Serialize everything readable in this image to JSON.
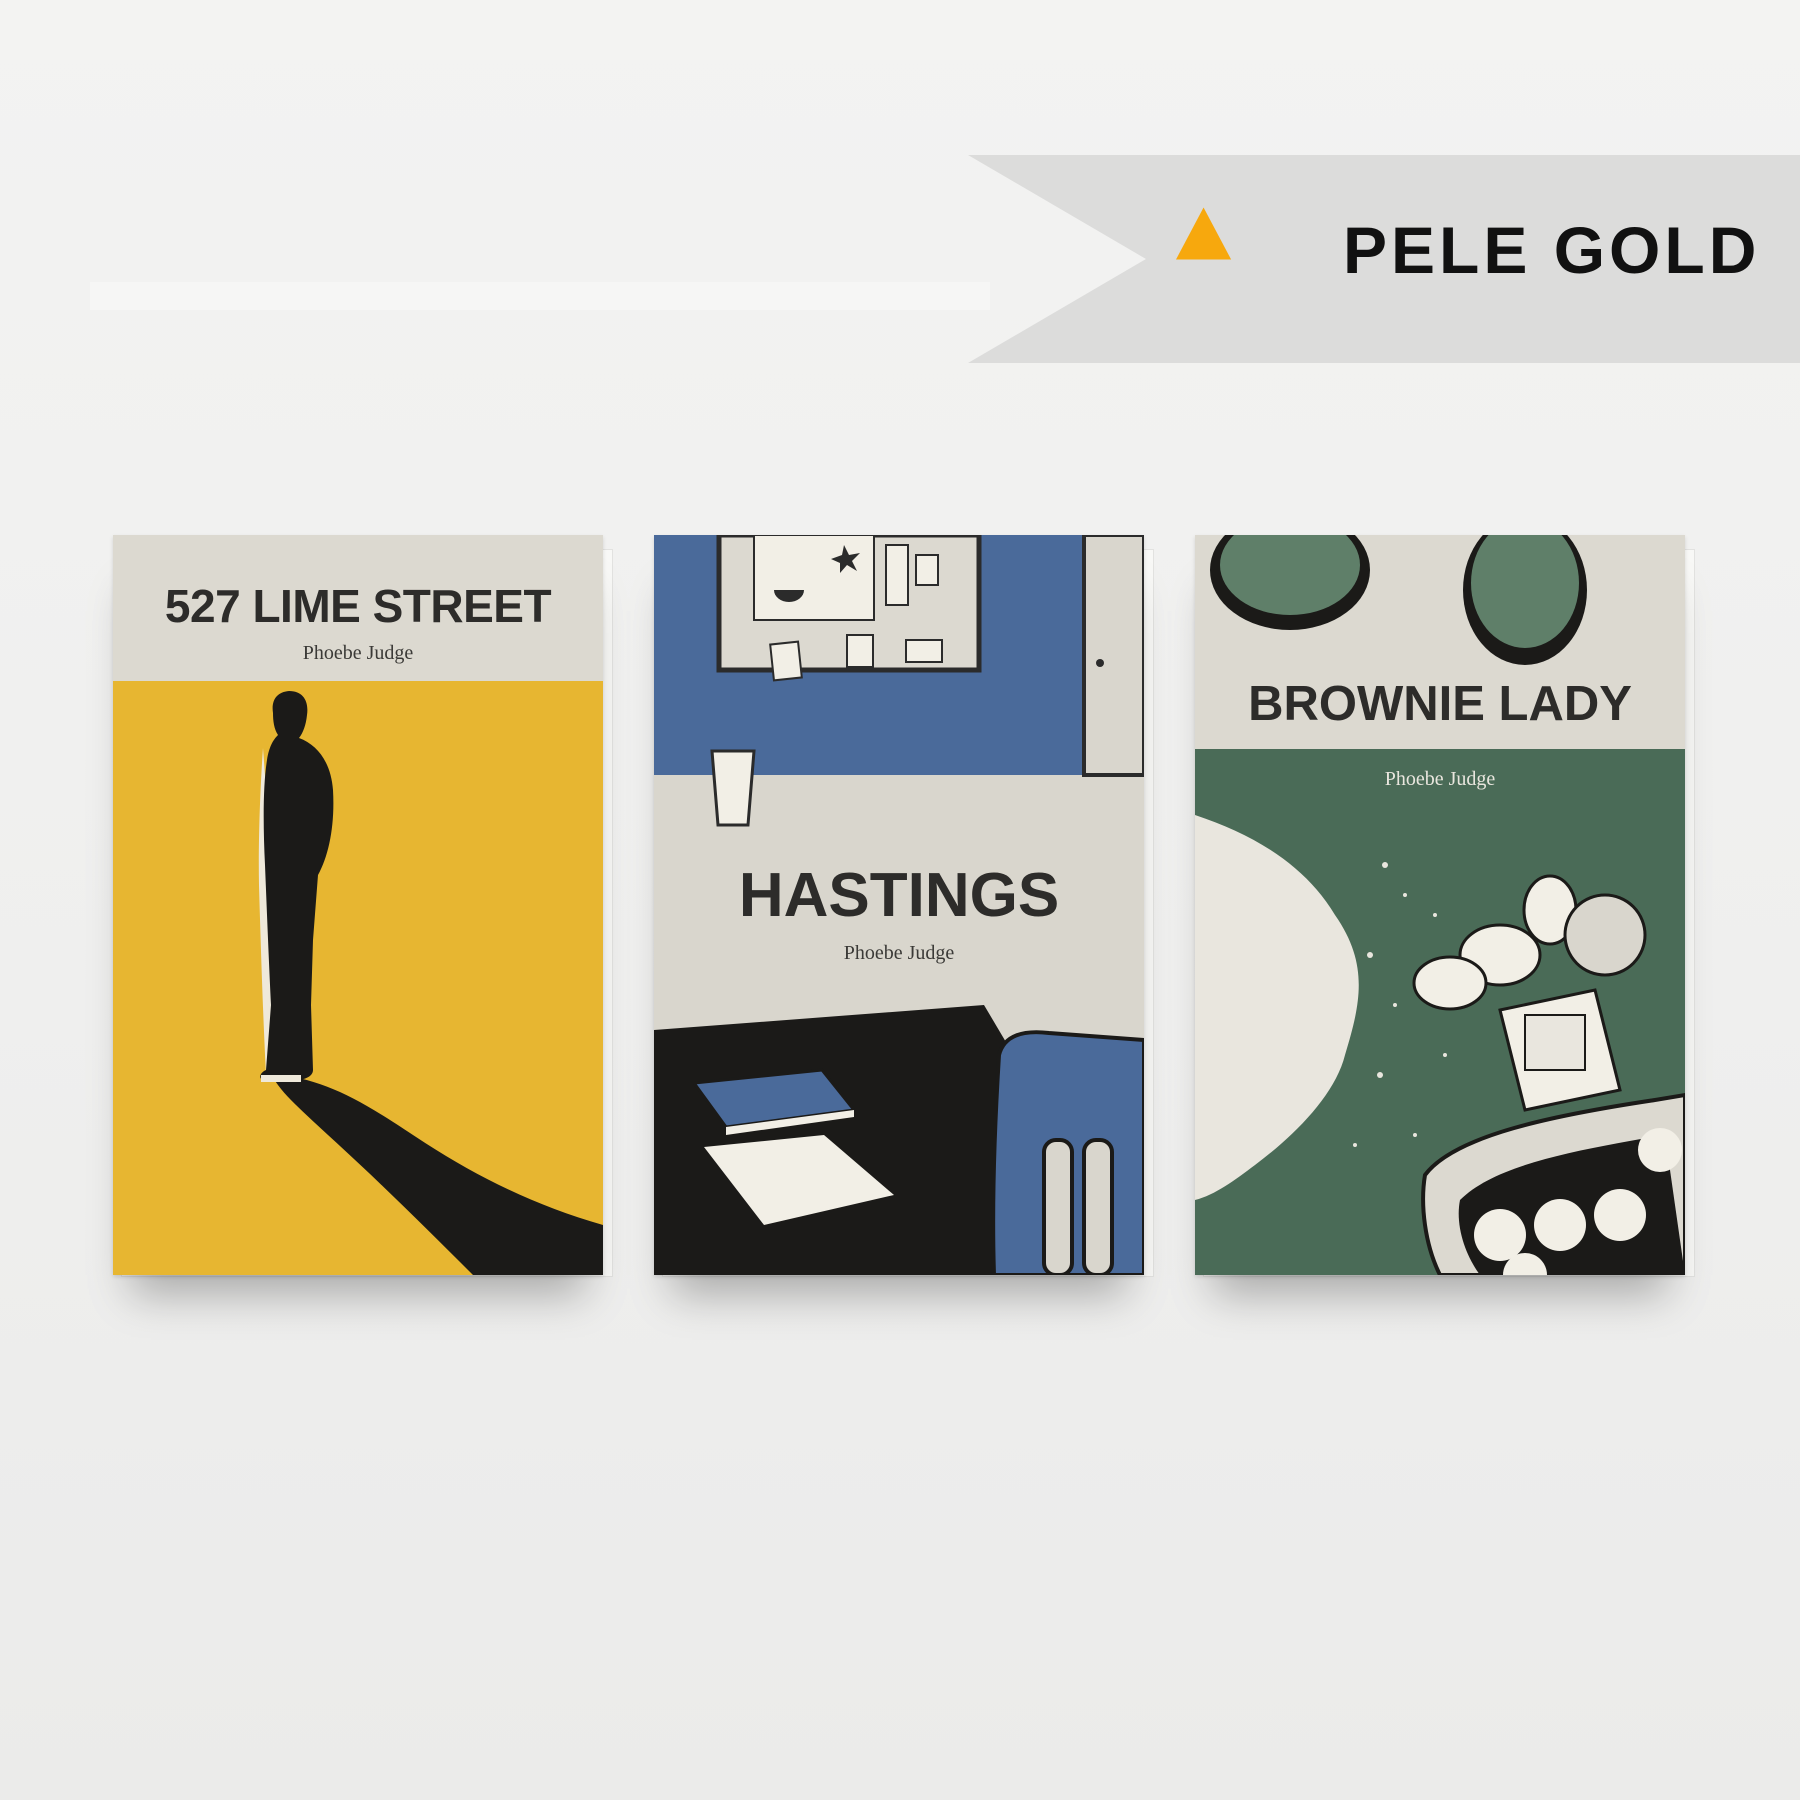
{
  "award": {
    "label": "PELE GOLD",
    "icon": "triangle-icon",
    "accent_color": "#f7a80d",
    "banner_color": "#dcdcdb"
  },
  "books": [
    {
      "title": "527 LIME STREET",
      "author": "Phoebe Judge",
      "cover_color": "#e7b631",
      "illustration": "silhouette-figure"
    },
    {
      "title": "HASTINGS",
      "author": "Phoebe Judge",
      "cover_color": "#4a6a9a",
      "illustration": "office-desk"
    },
    {
      "title": "BROWNIE LADY",
      "author": "Phoebe Judge",
      "cover_color": "#4a6b57",
      "illustration": "baking-scene"
    }
  ]
}
